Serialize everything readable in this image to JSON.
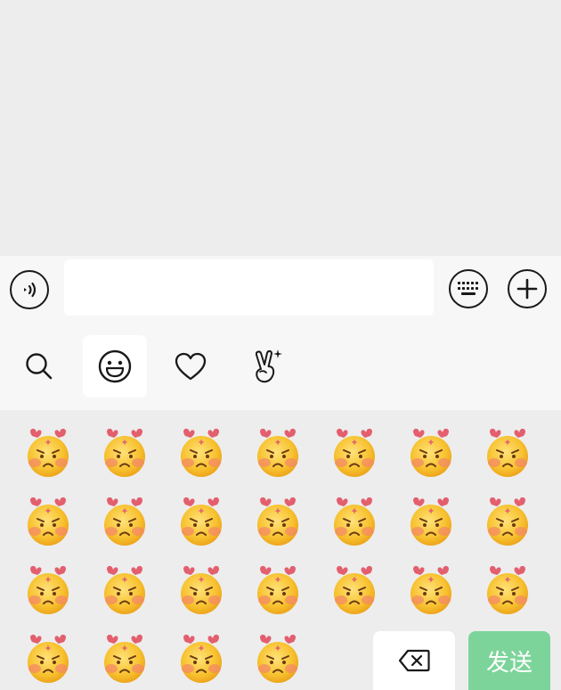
{
  "input": {
    "value": "",
    "placeholder": ""
  },
  "tabs": [
    {
      "icon": "search-icon",
      "active": false
    },
    {
      "icon": "smiley-face-icon",
      "active": true
    },
    {
      "icon": "heart-icon",
      "active": false
    },
    {
      "icon": "peace-hand-sparkle-icon",
      "active": false
    }
  ],
  "emoji_grid": {
    "emoji_name": "angry-face-with-pink-bow",
    "rows": [
      7,
      7,
      7,
      4
    ],
    "count": 25
  },
  "actions": {
    "delete_icon": "backspace-icon",
    "send_label": "发送"
  },
  "colors": {
    "background": "#ededed",
    "bar": "#f7f7f7",
    "send_button": "#7dd49a",
    "emoji_face": "#f7c12e",
    "emoji_bow": "#e35f6e"
  }
}
